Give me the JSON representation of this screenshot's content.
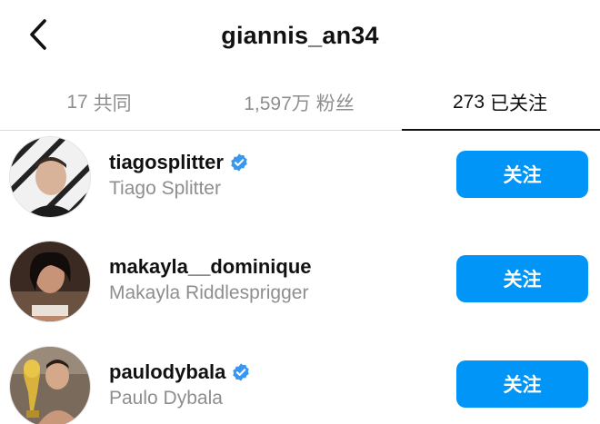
{
  "header": {
    "title": "giannis_an34",
    "back_icon": "chevron-left-icon"
  },
  "tabs": [
    {
      "count": "17",
      "label": "共同"
    },
    {
      "count": "1,597万",
      "label": "粉丝"
    },
    {
      "count": "273",
      "label": "已关注",
      "active": true
    }
  ],
  "users": [
    {
      "username": "tiagosplitter",
      "full_name": "Tiago Splitter",
      "verified": true,
      "button_label": "关注"
    },
    {
      "username": "makayla__dominique",
      "full_name": "Makayla Riddlesprigger",
      "verified": false,
      "button_label": "关注"
    },
    {
      "username": "paulodybala",
      "full_name": "Paulo Dybala",
      "verified": true,
      "button_label": "关注"
    }
  ],
  "colors": {
    "accent": "#0095f6",
    "secondary_text": "#8e8e8e",
    "verified_badge": "#3897f0"
  }
}
